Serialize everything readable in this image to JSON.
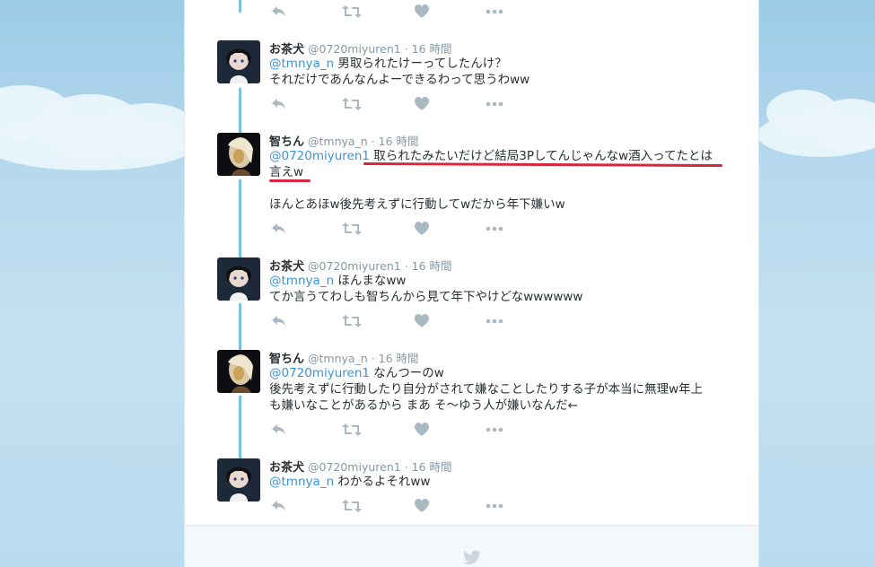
{
  "tweets": [
    {
      "name": "お茶犬",
      "handle": "@0720miyuren1",
      "time": "· 16 時間",
      "mention": "@tmnya_n",
      "text1": " 男取られたけーってしたんけ？",
      "text2": "それだけであんなんよーできるわって思うわww",
      "text3": ""
    },
    {
      "name": "智ちん",
      "handle": "@tmnya_n",
      "time": "· 16 時間",
      "mention": "@0720miyuren1",
      "text1": " 取られたみたいだけど結局3Pしてんじゃんなw酒入ってたとは",
      "text2": "言えw",
      "text3": "ほんとあほw後先考えずに行動してwだから年下嫌いw"
    },
    {
      "name": "お茶犬",
      "handle": "@0720miyuren1",
      "time": "· 16 時間",
      "mention": "@tmnya_n",
      "text1": " ほんまなww",
      "text2": "てか言うてわしも智ちんから見て年下やけどなwwwwww",
      "text3": ""
    },
    {
      "name": "智ちん",
      "handle": "@tmnya_n",
      "time": "· 16 時間",
      "mention": "@0720miyuren1",
      "text1": " なんつーのw",
      "text2": "後先考えずに行動したり自分がされて嫌なことしたりする子が本当に無理w年上",
      "text3": "も嫌いなことがあるから まあ そ～ゆう人が嫌いなんだ←"
    },
    {
      "name": "お茶犬",
      "handle": "@0720miyuren1",
      "time": "· 16 時間",
      "mention": "@tmnya_n",
      "text1": " わかるよそれww",
      "text2": "",
      "text3": ""
    }
  ],
  "icons": {
    "reply": "reply-icon",
    "retweet": "retweet-icon",
    "like": "heart-icon",
    "more": "more-icon",
    "footer": "bird-icon"
  },
  "colors": {
    "mention": "#3b94d9",
    "conversation_line": "#7cc3e0",
    "annotation": "#d7263d"
  }
}
